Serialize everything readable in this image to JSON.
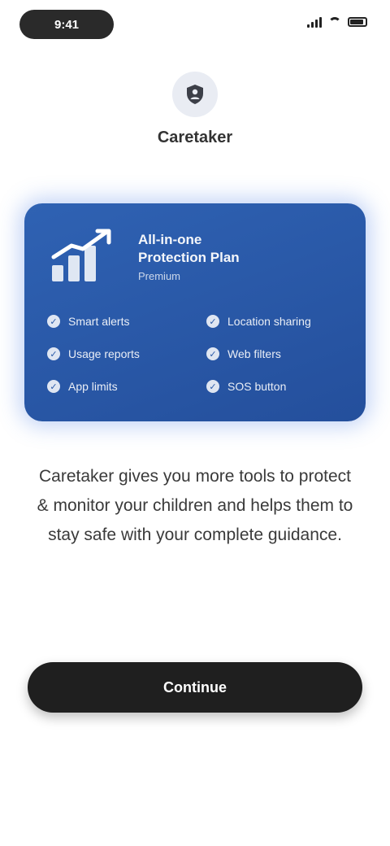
{
  "status_bar": {
    "time": "9:41"
  },
  "brand": {
    "name": "Caretaker",
    "icon": "shield-person-icon"
  },
  "promo": {
    "title_line1": "All-in-one",
    "title_line2": "Protection Plan",
    "subtitle": "Premium",
    "logo_icon": "growth-chart-icon",
    "features": [
      {
        "label": "Smart alerts"
      },
      {
        "label": "Location sharing"
      },
      {
        "label": "Usage reports"
      },
      {
        "label": "Web filters"
      },
      {
        "label": "App limits"
      },
      {
        "label": "SOS button"
      }
    ]
  },
  "description": "Caretaker gives you more tools to protect & monitor your children and helps them to stay safe with your complete guidance.",
  "cta": {
    "label": "Continue"
  },
  "colors": {
    "card": "#2a5aa8",
    "cta": "#1f1f1f",
    "background": "#ffffff"
  }
}
